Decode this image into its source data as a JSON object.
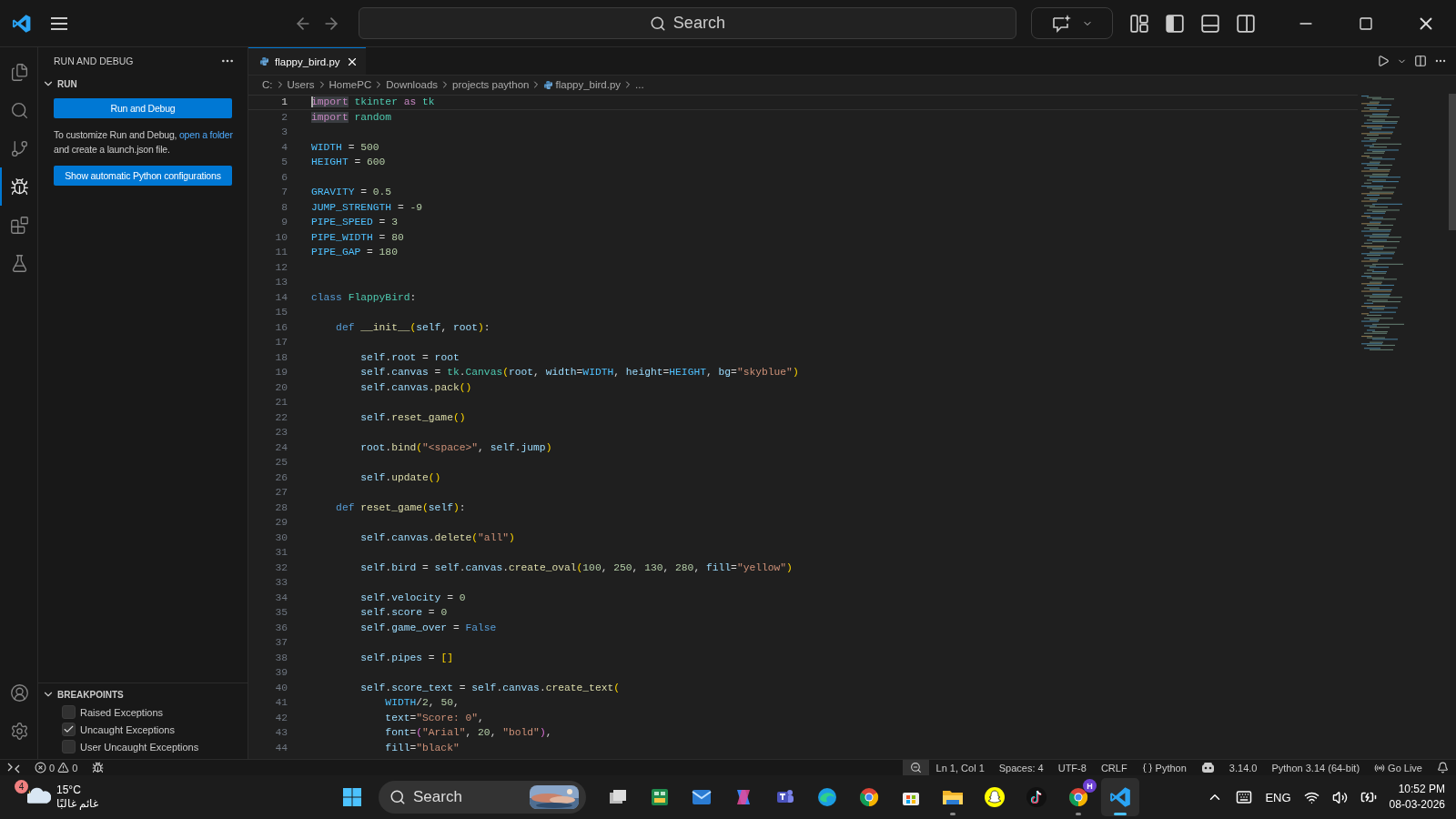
{
  "title_bar": {
    "search_placeholder": "Search",
    "layout_toggles": [
      {
        "kind": "layout",
        "on": false
      },
      {
        "kind": "sidebar",
        "on": true
      },
      {
        "kind": "panel",
        "on": false
      },
      {
        "kind": "secondary",
        "on": false
      }
    ]
  },
  "activity_bar": {
    "items": [
      {
        "kind": "files",
        "selected": false
      },
      {
        "kind": "search",
        "selected": false
      },
      {
        "kind": "source-control",
        "selected": false
      },
      {
        "kind": "run-debug",
        "selected": true
      },
      {
        "kind": "extensions",
        "selected": false
      },
      {
        "kind": "testing",
        "selected": false
      }
    ],
    "bottom": [
      {
        "kind": "account"
      },
      {
        "kind": "settings"
      }
    ]
  },
  "sidebar": {
    "title": "RUN AND DEBUG",
    "run_section": {
      "title": "RUN",
      "expanded": true,
      "run_button": "Run and Debug",
      "hint": {
        "before": "To customize Run and Debug, ",
        "link": "open a folder",
        "after": " and create a launch.json file."
      },
      "config_button": "Show automatic Python configurations"
    },
    "breakpoints": {
      "title": "BREAKPOINTS",
      "expanded": true,
      "items": [
        {
          "label": "Raised Exceptions",
          "checked": false
        },
        {
          "label": "Uncaught Exceptions",
          "checked": true
        },
        {
          "label": "User Uncaught Exceptions",
          "checked": false
        }
      ]
    }
  },
  "editor": {
    "tabs": [
      {
        "label": "flappy_bird.py",
        "selected": true
      }
    ],
    "breadcrumbs": [
      {
        "label": "C:",
        "kind": "plain"
      },
      {
        "label": "Users",
        "kind": "plain"
      },
      {
        "label": "HomePC",
        "kind": "plain"
      },
      {
        "label": "Downloads",
        "kind": "plain"
      },
      {
        "label": "projects paython",
        "kind": "plain"
      },
      {
        "label": "flappy_bird.py",
        "kind": "file"
      },
      {
        "label": "...",
        "kind": "plain"
      }
    ],
    "lines": [
      {
        "number": "1",
        "selected": true,
        "tokens": [
          {
            "kind": "kh",
            "text": "import"
          },
          {
            "kind": "t",
            "text": " tkinter"
          },
          {
            "kind": "k",
            "text": " as"
          },
          {
            "kind": "t",
            "text": " tk"
          }
        ]
      },
      {
        "number": "2",
        "selected": false,
        "tokens": [
          {
            "kind": "kh",
            "text": "import"
          },
          {
            "kind": "t",
            "text": " random"
          }
        ]
      },
      {
        "number": "3",
        "selected": false
      },
      {
        "number": "4",
        "selected": false,
        "tokens": [
          {
            "kind": "c",
            "text": "WIDTH"
          },
          {
            "kind": "p",
            "text": " = "
          },
          {
            "kind": "n",
            "text": "500"
          }
        ]
      },
      {
        "number": "5",
        "selected": false,
        "tokens": [
          {
            "kind": "c",
            "text": "HEIGHT"
          },
          {
            "kind": "p",
            "text": " = "
          },
          {
            "kind": "n",
            "text": "600"
          }
        ]
      },
      {
        "number": "6",
        "selected": false
      },
      {
        "number": "7",
        "selected": false,
        "tokens": [
          {
            "kind": "c",
            "text": "GRAVITY"
          },
          {
            "kind": "p",
            "text": " = "
          },
          {
            "kind": "n",
            "text": "0.5"
          }
        ]
      },
      {
        "number": "8",
        "selected": false,
        "tokens": [
          {
            "kind": "c",
            "text": "JUMP_STRENGTH"
          },
          {
            "kind": "p",
            "text": " = "
          },
          {
            "kind": "n",
            "text": "-9"
          }
        ]
      },
      {
        "number": "9",
        "selected": false,
        "tokens": [
          {
            "kind": "c",
            "text": "PIPE_SPEED"
          },
          {
            "kind": "p",
            "text": " = "
          },
          {
            "kind": "n",
            "text": "3"
          }
        ]
      },
      {
        "number": "10",
        "selected": false,
        "tokens": [
          {
            "kind": "c",
            "text": "PIPE_WIDTH"
          },
          {
            "kind": "p",
            "text": " = "
          },
          {
            "kind": "n",
            "text": "80"
          }
        ]
      },
      {
        "number": "11",
        "selected": false,
        "tokens": [
          {
            "kind": "c",
            "text": "PIPE_GAP"
          },
          {
            "kind": "p",
            "text": " = "
          },
          {
            "kind": "n",
            "text": "180"
          }
        ]
      },
      {
        "number": "12",
        "selected": false
      },
      {
        "number": "13",
        "selected": false
      },
      {
        "number": "14",
        "selected": false,
        "tokens": [
          {
            "kind": "d",
            "text": "class"
          },
          {
            "kind": "t",
            "text": " FlappyBird"
          },
          {
            "kind": "p",
            "text": ":"
          }
        ]
      },
      {
        "number": "15",
        "selected": false
      },
      {
        "number": "16",
        "selected": false,
        "tokens": [
          {
            "kind": "d",
            "text": "    def"
          },
          {
            "kind": "f",
            "text": " __init__"
          },
          {
            "kind": "b1",
            "text": "("
          },
          {
            "kind": "v",
            "text": "self"
          },
          {
            "kind": "p",
            "text": ", "
          },
          {
            "kind": "v",
            "text": "root"
          },
          {
            "kind": "b1",
            "text": ")"
          },
          {
            "kind": "p",
            "text": ":"
          }
        ]
      },
      {
        "number": "17",
        "selected": false
      },
      {
        "number": "18",
        "selected": false,
        "tokens": [
          {
            "kind": "v",
            "text": "        self"
          },
          {
            "kind": "p",
            "text": "."
          },
          {
            "kind": "v",
            "text": "root"
          },
          {
            "kind": "p",
            "text": " = "
          },
          {
            "kind": "v",
            "text": "root"
          }
        ]
      },
      {
        "number": "19",
        "selected": false,
        "tokens": [
          {
            "kind": "v",
            "text": "        self"
          },
          {
            "kind": "p",
            "text": "."
          },
          {
            "kind": "v",
            "text": "canvas"
          },
          {
            "kind": "p",
            "text": " = "
          },
          {
            "kind": "t",
            "text": "tk"
          },
          {
            "kind": "p",
            "text": "."
          },
          {
            "kind": "t",
            "text": "Canvas"
          },
          {
            "kind": "b1",
            "text": "("
          },
          {
            "kind": "v",
            "text": "root"
          },
          {
            "kind": "p",
            "text": ", "
          },
          {
            "kind": "v",
            "text": "width"
          },
          {
            "kind": "p",
            "text": "="
          },
          {
            "kind": "c",
            "text": "WIDTH"
          },
          {
            "kind": "p",
            "text": ", "
          },
          {
            "kind": "v",
            "text": "height"
          },
          {
            "kind": "p",
            "text": "="
          },
          {
            "kind": "c",
            "text": "HEIGHT"
          },
          {
            "kind": "p",
            "text": ", "
          },
          {
            "kind": "v",
            "text": "bg"
          },
          {
            "kind": "p",
            "text": "="
          },
          {
            "kind": "s",
            "text": "\"skyblue\""
          },
          {
            "kind": "b1",
            "text": ")"
          }
        ]
      },
      {
        "number": "20",
        "selected": false,
        "tokens": [
          {
            "kind": "v",
            "text": "        self"
          },
          {
            "kind": "p",
            "text": "."
          },
          {
            "kind": "v",
            "text": "canvas"
          },
          {
            "kind": "p",
            "text": "."
          },
          {
            "kind": "f",
            "text": "pack"
          },
          {
            "kind": "b1",
            "text": "()"
          }
        ]
      },
      {
        "number": "21",
        "selected": false
      },
      {
        "number": "22",
        "selected": false,
        "tokens": [
          {
            "kind": "v",
            "text": "        self"
          },
          {
            "kind": "p",
            "text": "."
          },
          {
            "kind": "f",
            "text": "reset_game"
          },
          {
            "kind": "b1",
            "text": "()"
          }
        ]
      },
      {
        "number": "23",
        "selected": false
      },
      {
        "number": "24",
        "selected": false,
        "tokens": [
          {
            "kind": "v",
            "text": "        root"
          },
          {
            "kind": "p",
            "text": "."
          },
          {
            "kind": "f",
            "text": "bind"
          },
          {
            "kind": "b1",
            "text": "("
          },
          {
            "kind": "s",
            "text": "\"<space>\""
          },
          {
            "kind": "p",
            "text": ", "
          },
          {
            "kind": "v",
            "text": "self"
          },
          {
            "kind": "p",
            "text": "."
          },
          {
            "kind": "v",
            "text": "jump"
          },
          {
            "kind": "b1",
            "text": ")"
          }
        ]
      },
      {
        "number": "25",
        "selected": false
      },
      {
        "number": "26",
        "selected": false,
        "tokens": [
          {
            "kind": "v",
            "text": "        self"
          },
          {
            "kind": "p",
            "text": "."
          },
          {
            "kind": "f",
            "text": "update"
          },
          {
            "kind": "b1",
            "text": "()"
          }
        ]
      },
      {
        "number": "27",
        "selected": false
      },
      {
        "number": "28",
        "selected": false,
        "tokens": [
          {
            "kind": "d",
            "text": "    def"
          },
          {
            "kind": "f",
            "text": " reset_game"
          },
          {
            "kind": "b1",
            "text": "("
          },
          {
            "kind": "v",
            "text": "self"
          },
          {
            "kind": "b1",
            "text": ")"
          },
          {
            "kind": "p",
            "text": ":"
          }
        ]
      },
      {
        "number": "29",
        "selected": false
      },
      {
        "number": "30",
        "selected": false,
        "tokens": [
          {
            "kind": "v",
            "text": "        self"
          },
          {
            "kind": "p",
            "text": "."
          },
          {
            "kind": "v",
            "text": "canvas"
          },
          {
            "kind": "p",
            "text": "."
          },
          {
            "kind": "f",
            "text": "delete"
          },
          {
            "kind": "b1",
            "text": "("
          },
          {
            "kind": "s",
            "text": "\"all\""
          },
          {
            "kind": "b1",
            "text": ")"
          }
        ]
      },
      {
        "number": "31",
        "selected": false
      },
      {
        "number": "32",
        "selected": false,
        "tokens": [
          {
            "kind": "v",
            "text": "        self"
          },
          {
            "kind": "p",
            "text": "."
          },
          {
            "kind": "v",
            "text": "bird"
          },
          {
            "kind": "p",
            "text": " = "
          },
          {
            "kind": "v",
            "text": "self"
          },
          {
            "kind": "p",
            "text": "."
          },
          {
            "kind": "v",
            "text": "canvas"
          },
          {
            "kind": "p",
            "text": "."
          },
          {
            "kind": "f",
            "text": "create_oval"
          },
          {
            "kind": "b1",
            "text": "("
          },
          {
            "kind": "n",
            "text": "100"
          },
          {
            "kind": "p",
            "text": ", "
          },
          {
            "kind": "n",
            "text": "250"
          },
          {
            "kind": "p",
            "text": ", "
          },
          {
            "kind": "n",
            "text": "130"
          },
          {
            "kind": "p",
            "text": ", "
          },
          {
            "kind": "n",
            "text": "280"
          },
          {
            "kind": "p",
            "text": ", "
          },
          {
            "kind": "v",
            "text": "fill"
          },
          {
            "kind": "p",
            "text": "="
          },
          {
            "kind": "s",
            "text": "\"yellow\""
          },
          {
            "kind": "b1",
            "text": ")"
          }
        ]
      },
      {
        "number": "33",
        "selected": false
      },
      {
        "number": "34",
        "selected": false,
        "tokens": [
          {
            "kind": "v",
            "text": "        self"
          },
          {
            "kind": "p",
            "text": "."
          },
          {
            "kind": "v",
            "text": "velocity"
          },
          {
            "kind": "p",
            "text": " = "
          },
          {
            "kind": "n",
            "text": "0"
          }
        ]
      },
      {
        "number": "35",
        "selected": false,
        "tokens": [
          {
            "kind": "v",
            "text": "        self"
          },
          {
            "kind": "p",
            "text": "."
          },
          {
            "kind": "v",
            "text": "score"
          },
          {
            "kind": "p",
            "text": " = "
          },
          {
            "kind": "n",
            "text": "0"
          }
        ]
      },
      {
        "number": "36",
        "selected": false,
        "tokens": [
          {
            "kind": "v",
            "text": "        self"
          },
          {
            "kind": "p",
            "text": "."
          },
          {
            "kind": "v",
            "text": "game_over"
          },
          {
            "kind": "p",
            "text": " = "
          },
          {
            "kind": "d",
            "text": "False"
          }
        ]
      },
      {
        "number": "37",
        "selected": false
      },
      {
        "number": "38",
        "selected": false,
        "tokens": [
          {
            "kind": "v",
            "text": "        self"
          },
          {
            "kind": "p",
            "text": "."
          },
          {
            "kind": "v",
            "text": "pipes"
          },
          {
            "kind": "p",
            "text": " = "
          },
          {
            "kind": "b1",
            "text": "[]"
          }
        ]
      },
      {
        "number": "39",
        "selected": false
      },
      {
        "number": "40",
        "selected": false,
        "tokens": [
          {
            "kind": "v",
            "text": "        self"
          },
          {
            "kind": "p",
            "text": "."
          },
          {
            "kind": "v",
            "text": "score_text"
          },
          {
            "kind": "p",
            "text": " = "
          },
          {
            "kind": "v",
            "text": "self"
          },
          {
            "kind": "p",
            "text": "."
          },
          {
            "kind": "v",
            "text": "canvas"
          },
          {
            "kind": "p",
            "text": "."
          },
          {
            "kind": "f",
            "text": "create_text"
          },
          {
            "kind": "b1",
            "text": "("
          }
        ]
      },
      {
        "number": "41",
        "selected": false,
        "tokens": [
          {
            "kind": "c",
            "text": "            WIDTH"
          },
          {
            "kind": "p",
            "text": "/"
          },
          {
            "kind": "n",
            "text": "2"
          },
          {
            "kind": "p",
            "text": ", "
          },
          {
            "kind": "n",
            "text": "50"
          },
          {
            "kind": "p",
            "text": ","
          }
        ]
      },
      {
        "number": "42",
        "selected": false,
        "tokens": [
          {
            "kind": "v",
            "text": "            text"
          },
          {
            "kind": "p",
            "text": "="
          },
          {
            "kind": "s",
            "text": "\"Score: 0\""
          },
          {
            "kind": "p",
            "text": ","
          }
        ]
      },
      {
        "number": "43",
        "selected": false,
        "tokens": [
          {
            "kind": "v",
            "text": "            font"
          },
          {
            "kind": "p",
            "text": "="
          },
          {
            "kind": "b2",
            "text": "("
          },
          {
            "kind": "s",
            "text": "\"Arial\""
          },
          {
            "kind": "p",
            "text": ", "
          },
          {
            "kind": "n",
            "text": "20"
          },
          {
            "kind": "p",
            "text": ", "
          },
          {
            "kind": "s",
            "text": "\"bold\""
          },
          {
            "kind": "b2",
            "text": ")"
          },
          {
            "kind": "p",
            "text": ","
          }
        ]
      },
      {
        "number": "44",
        "selected": false,
        "tokens": [
          {
            "kind": "v",
            "text": "            fill"
          },
          {
            "kind": "p",
            "text": "="
          },
          {
            "kind": "s",
            "text": "\"black\""
          }
        ]
      }
    ]
  },
  "status_bar": {
    "errors": "0",
    "warnings": "0",
    "right": [
      {
        "kind": "zoom"
      },
      {
        "kind": "text",
        "text": "Ln 1, Col 1"
      },
      {
        "kind": "text",
        "text": "Spaces: 4"
      },
      {
        "kind": "text",
        "text": "UTF-8"
      },
      {
        "kind": "text",
        "text": "CRLF"
      },
      {
        "kind": "language",
        "text": "Python"
      },
      {
        "kind": "copilot"
      },
      {
        "kind": "text",
        "text": "3.14.0"
      },
      {
        "kind": "text",
        "text": "Python 3.14 (64-bit)"
      },
      {
        "kind": "live",
        "text": "Go Live"
      },
      {
        "kind": "bell"
      }
    ]
  },
  "taskbar": {
    "weather": {
      "badge": "4",
      "temperature": "15°C",
      "condition": "غائم غالبًا"
    },
    "search": "Search",
    "apps": [
      {
        "kind": "task-view",
        "running": false,
        "selected": false
      },
      {
        "kind": "spreadsheet",
        "running": false,
        "selected": false
      },
      {
        "kind": "mail",
        "running": false,
        "selected": false
      },
      {
        "kind": "copilot",
        "running": false,
        "selected": false
      },
      {
        "kind": "teams",
        "running": false,
        "selected": false
      },
      {
        "kind": "edge",
        "running": false,
        "selected": false
      },
      {
        "kind": "chrome",
        "running": false,
        "selected": false
      },
      {
        "kind": "store",
        "running": false,
        "selected": false
      },
      {
        "kind": "folder",
        "running": true,
        "selected": false
      },
      {
        "kind": "ghost",
        "running": false,
        "selected": false
      },
      {
        "kind": "note",
        "running": false,
        "selected": false
      },
      {
        "kind": "chrome",
        "badge": "H",
        "running": true,
        "selected": false
      },
      {
        "kind": "code",
        "running": true,
        "selected": true
      }
    ],
    "language": "ENG",
    "time": "10:52 PM",
    "date": "08-03-2026"
  }
}
